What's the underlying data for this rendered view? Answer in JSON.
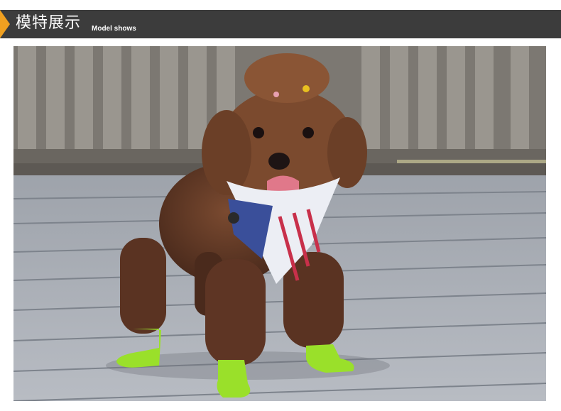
{
  "header": {
    "title": "模特展示",
    "subtitle": "Model shows",
    "bar_color": "#3c3c3c",
    "accent_color": "#f0a020"
  },
  "photo": {
    "subject": "poodle-wearing-dog-boots",
    "boot_color": "#9ae02a"
  }
}
